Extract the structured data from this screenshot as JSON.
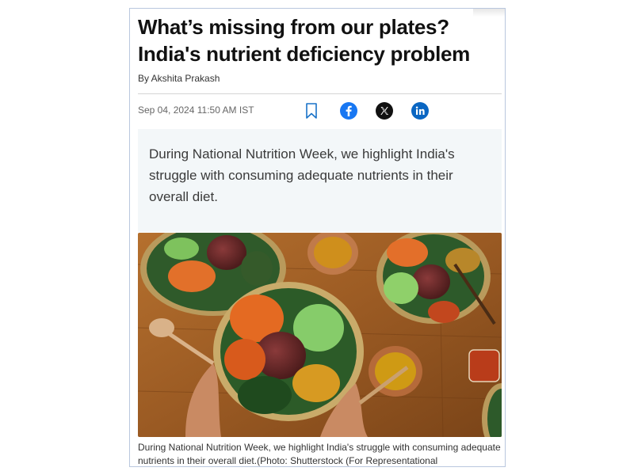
{
  "article": {
    "title": "What’s missing from our plates? India's nutrient deficiency problem",
    "byline": "By Akshita Prakash",
    "date": "Sep 04, 2024 11:50 AM IST",
    "summary": "During National Nutrition Week, we highlight India's struggle with consuming adequate nutrients in their overall diet.",
    "caption": "During National Nutrition Week, we highlight India's struggle with consuming adequate nutrients in their overall diet.(Photo: Shutterstock (For Representational"
  },
  "share": {
    "icons": [
      "bookmark-icon",
      "facebook-icon",
      "x-icon",
      "linkedin-icon"
    ],
    "colors": {
      "facebook": "#1877f2",
      "x": "#111111",
      "linkedin": "#0a66c2",
      "bookmark": "#1a73c8"
    }
  },
  "image": {
    "semantic": "food-bowls-photo"
  }
}
